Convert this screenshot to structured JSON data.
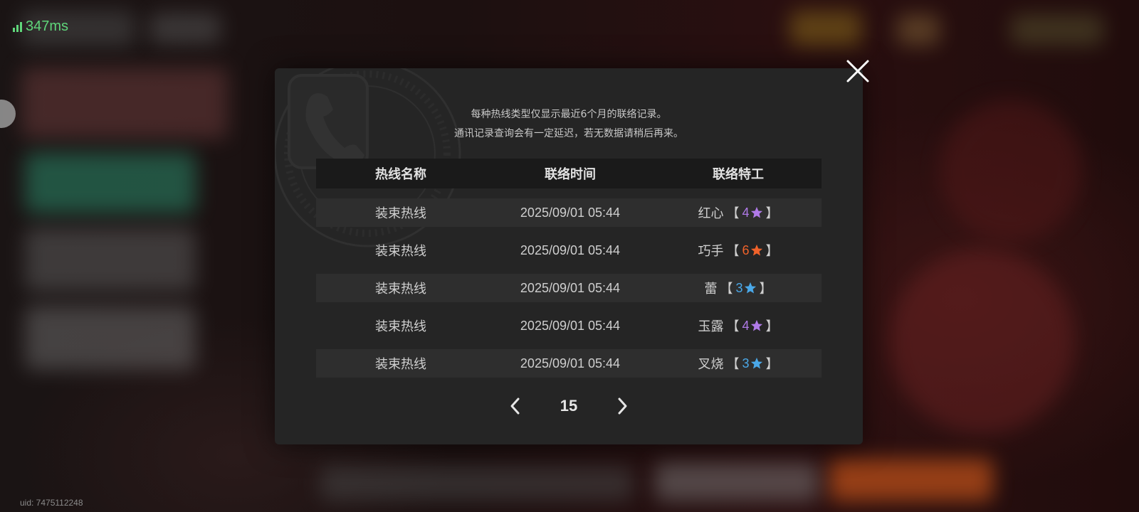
{
  "status": {
    "ping": "347ms",
    "uid": "uid: 7475112248"
  },
  "dialog": {
    "notice_line1": "每种热线类型仅显示最近6个月的联络记录。",
    "notice_line2": "通讯记录查询会有一定延迟，若无数据请稍后再来。",
    "headers": {
      "line_name": "热线名称",
      "contact_time": "联络时间",
      "agent": "联络特工"
    },
    "rows": [
      {
        "line_name": "装束热线",
        "time": "2025/09/01 05:44",
        "agent": "红心",
        "rank": "4",
        "rank_color": "#b07ae8"
      },
      {
        "line_name": "装束热线",
        "time": "2025/09/01 05:44",
        "agent": "巧手",
        "rank": "6",
        "rank_color": "#f0622a"
      },
      {
        "line_name": "装束热线",
        "time": "2025/09/01 05:44",
        "agent": "蕾",
        "rank": "3",
        "rank_color": "#4aa8e8"
      },
      {
        "line_name": "装束热线",
        "time": "2025/09/01 05:44",
        "agent": "玉露",
        "rank": "4",
        "rank_color": "#b07ae8"
      },
      {
        "line_name": "装束热线",
        "time": "2025/09/01 05:44",
        "agent": "叉烧",
        "rank": "3",
        "rank_color": "#4aa8e8"
      }
    ],
    "pagination": {
      "page": "15"
    },
    "icons": {
      "close": "close-icon",
      "prev": "chevron-left-icon",
      "next": "chevron-right-icon",
      "star": "star-icon"
    }
  }
}
